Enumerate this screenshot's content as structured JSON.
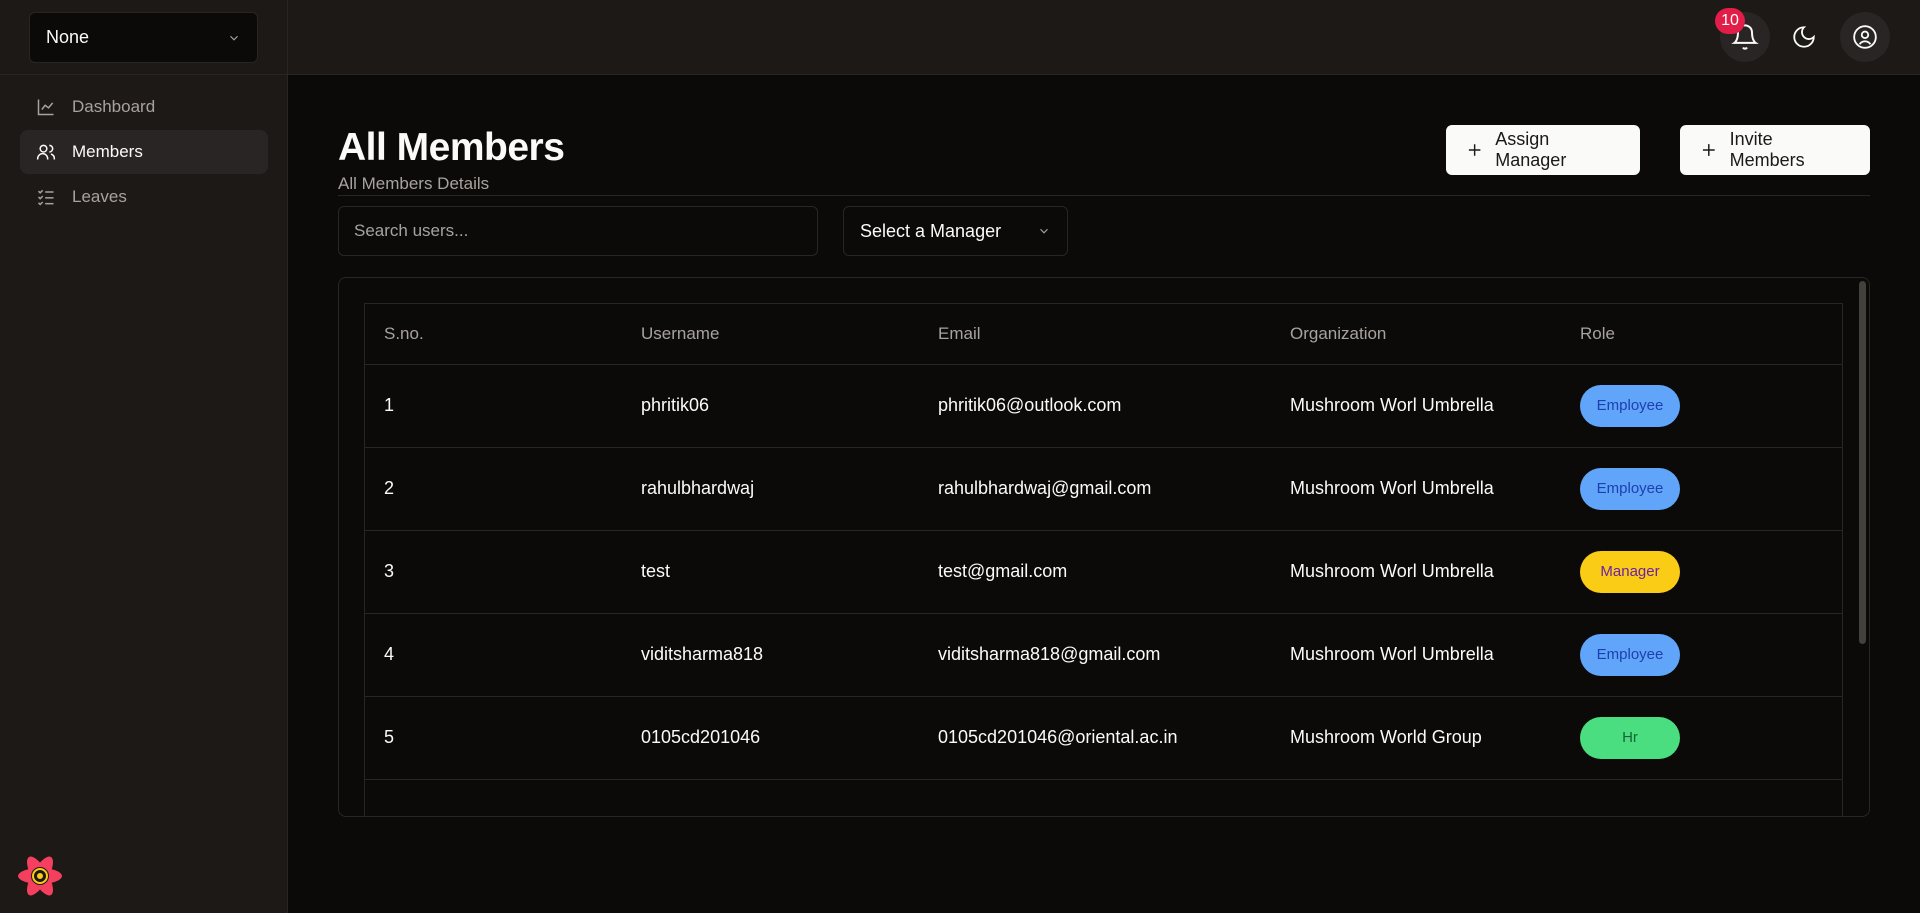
{
  "sidebar": {
    "org_select": "None",
    "nav": [
      {
        "label": "Dashboard",
        "icon": "chart-line-icon",
        "active": false
      },
      {
        "label": "Members",
        "icon": "users-icon",
        "active": true
      },
      {
        "label": "Leaves",
        "icon": "list-checks-icon",
        "active": false
      }
    ]
  },
  "topbar": {
    "notification_count": "10"
  },
  "page": {
    "title": "All Members",
    "subtitle": "All Members Details",
    "assign_button": "Assign Manager",
    "invite_button": "Invite Members"
  },
  "filters": {
    "search_placeholder": "Search users...",
    "manager_select": "Select a Manager"
  },
  "table": {
    "headers": [
      "S.no.",
      "Username",
      "Email",
      "Organization",
      "Role"
    ],
    "rows": [
      {
        "sno": "1",
        "username": "phritik06",
        "email": "phritik06@outlook.com",
        "organization": "Mushroom Worl Umbrella",
        "role": "Employee"
      },
      {
        "sno": "2",
        "username": "rahulbhardwaj",
        "email": "rahulbhardwaj@gmail.com",
        "organization": "Mushroom Worl Umbrella",
        "role": "Employee"
      },
      {
        "sno": "3",
        "username": "test",
        "email": "test@gmail.com",
        "organization": "Mushroom Worl Umbrella",
        "role": "Manager"
      },
      {
        "sno": "4",
        "username": "viditsharma818",
        "email": "viditsharma818@gmail.com",
        "organization": "Mushroom Worl Umbrella",
        "role": "Employee"
      },
      {
        "sno": "5",
        "username": "0105cd201046",
        "email": "0105cd201046@oriental.ac.in",
        "organization": "Mushroom World Group",
        "role": "Hr"
      }
    ]
  },
  "colors": {
    "background": "#0c0a09",
    "panel": "#1c1917",
    "employee": "#60a5fa",
    "manager": "#facc15",
    "hr": "#4ade80",
    "badge": "#e11d48"
  }
}
